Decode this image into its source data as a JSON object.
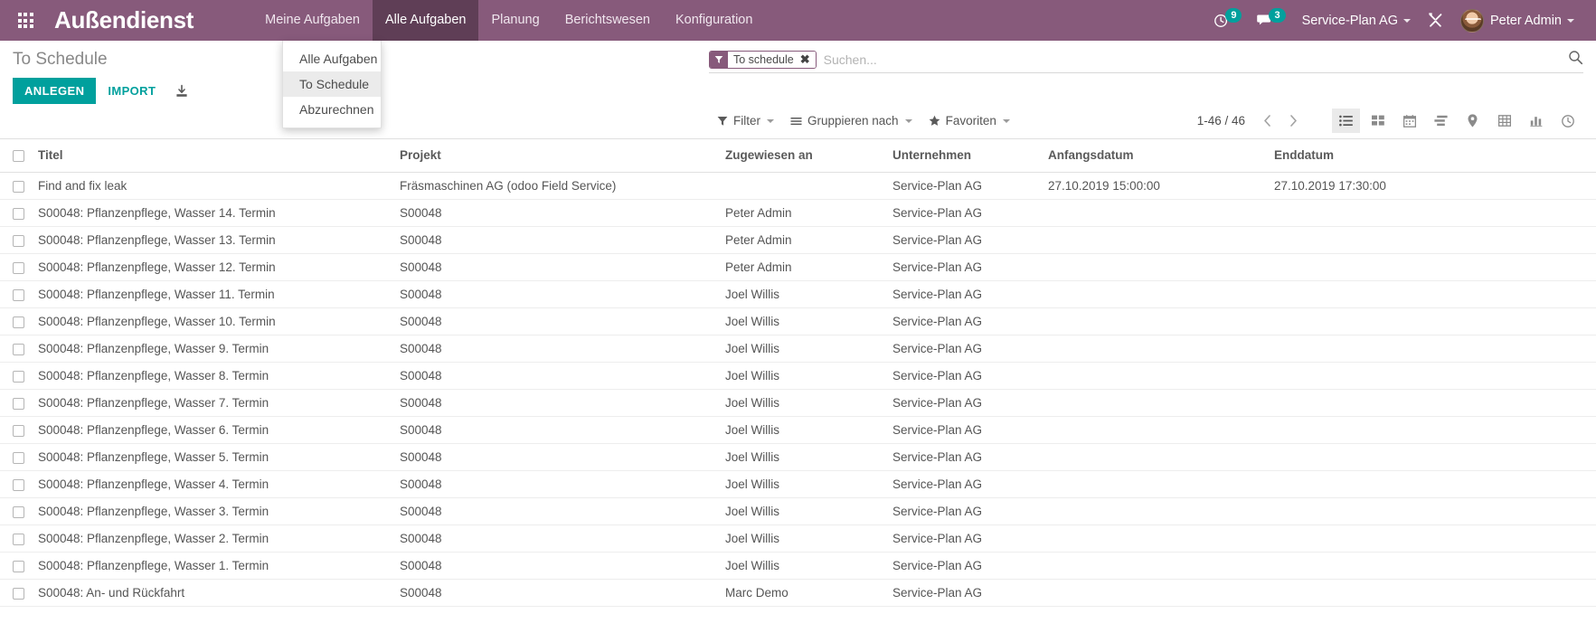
{
  "navbar": {
    "apps_icon": "apps-grid-icon",
    "brand": "Außendienst",
    "menu": [
      {
        "label": "Meine Aufgaben",
        "active": false
      },
      {
        "label": "Alle Aufgaben",
        "active": true
      },
      {
        "label": "Planung",
        "active": false
      },
      {
        "label": "Berichtswesen",
        "active": false
      },
      {
        "label": "Konfiguration",
        "active": false
      }
    ],
    "activity_count": "9",
    "messages_count": "3",
    "company": "Service-Plan AG",
    "debug_icon": "wrench-screwdriver-icon",
    "user": "Peter Admin"
  },
  "dropdown": {
    "items": [
      {
        "label": "Alle Aufgaben",
        "selected": false
      },
      {
        "label": "To Schedule",
        "selected": true
      },
      {
        "label": "Abzurechnen",
        "selected": false
      }
    ]
  },
  "control": {
    "title": "To Schedule",
    "create_label": "ANLEGEN",
    "import_label": "IMPORT",
    "download_icon": "download-icon",
    "search": {
      "facet_label": "To schedule",
      "facet_icon": "filter-funnel-icon",
      "facet_remove_icon": "remove-facet-icon",
      "placeholder": "Suchen...",
      "search_icon": "search-icon"
    },
    "filters": [
      {
        "label": "Filter",
        "icon": "filter-funnel-icon"
      },
      {
        "label": "Gruppieren nach",
        "icon": "bars-icon"
      },
      {
        "label": "Favoriten",
        "icon": "star-icon"
      }
    ],
    "pager": {
      "count": "1-46 / 46",
      "prev_icon": "chevron-left-icon",
      "next_icon": "chevron-right-icon"
    },
    "views": [
      {
        "name": "list-view",
        "icon": "list-icon",
        "active": true
      },
      {
        "name": "kanban-view",
        "icon": "kanban-icon",
        "active": false
      },
      {
        "name": "calendar-view",
        "icon": "calendar-icon",
        "active": false
      },
      {
        "name": "gantt-view",
        "icon": "gantt-icon",
        "active": false
      },
      {
        "name": "map-view",
        "icon": "map-pin-icon",
        "active": false
      },
      {
        "name": "pivot-view",
        "icon": "pivot-grid-icon",
        "active": false
      },
      {
        "name": "graph-view",
        "icon": "bar-chart-icon",
        "active": false
      },
      {
        "name": "activity-view",
        "icon": "clock-icon",
        "active": false
      }
    ]
  },
  "table": {
    "columns": [
      "Titel",
      "Projekt",
      "Zugewiesen an",
      "Unternehmen",
      "Anfangsdatum",
      "Enddatum"
    ],
    "rows": [
      {
        "title": "Find and fix leak",
        "project": "Fräsmaschinen AG (odoo Field Service)",
        "assigned": "",
        "company": "Service-Plan AG",
        "start": "27.10.2019 15:00:00",
        "end": "27.10.2019 17:30:00"
      },
      {
        "title": "S00048: Pflanzenpflege, Wasser 14. Termin",
        "project": "S00048",
        "assigned": "Peter Admin",
        "company": "Service-Plan AG",
        "start": "",
        "end": ""
      },
      {
        "title": "S00048: Pflanzenpflege, Wasser 13. Termin",
        "project": "S00048",
        "assigned": "Peter Admin",
        "company": "Service-Plan AG",
        "start": "",
        "end": ""
      },
      {
        "title": "S00048: Pflanzenpflege, Wasser 12. Termin",
        "project": "S00048",
        "assigned": "Peter Admin",
        "company": "Service-Plan AG",
        "start": "",
        "end": ""
      },
      {
        "title": "S00048: Pflanzenpflege, Wasser 11. Termin",
        "project": "S00048",
        "assigned": "Joel Willis",
        "company": "Service-Plan AG",
        "start": "",
        "end": ""
      },
      {
        "title": "S00048: Pflanzenpflege, Wasser 10. Termin",
        "project": "S00048",
        "assigned": "Joel Willis",
        "company": "Service-Plan AG",
        "start": "",
        "end": ""
      },
      {
        "title": "S00048: Pflanzenpflege, Wasser 9. Termin",
        "project": "S00048",
        "assigned": "Joel Willis",
        "company": "Service-Plan AG",
        "start": "",
        "end": ""
      },
      {
        "title": "S00048: Pflanzenpflege, Wasser 8. Termin",
        "project": "S00048",
        "assigned": "Joel Willis",
        "company": "Service-Plan AG",
        "start": "",
        "end": ""
      },
      {
        "title": "S00048: Pflanzenpflege, Wasser 7. Termin",
        "project": "S00048",
        "assigned": "Joel Willis",
        "company": "Service-Plan AG",
        "start": "",
        "end": ""
      },
      {
        "title": "S00048: Pflanzenpflege, Wasser 6. Termin",
        "project": "S00048",
        "assigned": "Joel Willis",
        "company": "Service-Plan AG",
        "start": "",
        "end": ""
      },
      {
        "title": "S00048: Pflanzenpflege, Wasser 5. Termin",
        "project": "S00048",
        "assigned": "Joel Willis",
        "company": "Service-Plan AG",
        "start": "",
        "end": ""
      },
      {
        "title": "S00048: Pflanzenpflege, Wasser 4. Termin",
        "project": "S00048",
        "assigned": "Joel Willis",
        "company": "Service-Plan AG",
        "start": "",
        "end": ""
      },
      {
        "title": "S00048: Pflanzenpflege, Wasser 3. Termin",
        "project": "S00048",
        "assigned": "Joel Willis",
        "company": "Service-Plan AG",
        "start": "",
        "end": ""
      },
      {
        "title": "S00048: Pflanzenpflege, Wasser 2. Termin",
        "project": "S00048",
        "assigned": "Joel Willis",
        "company": "Service-Plan AG",
        "start": "",
        "end": ""
      },
      {
        "title": "S00048: Pflanzenpflege, Wasser 1. Termin",
        "project": "S00048",
        "assigned": "Joel Willis",
        "company": "Service-Plan AG",
        "start": "",
        "end": ""
      },
      {
        "title": "S00048: An- und Rückfahrt",
        "project": "S00048",
        "assigned": "Marc Demo",
        "company": "Service-Plan AG",
        "start": "",
        "end": ""
      }
    ]
  },
  "colors": {
    "brand_purple": "#875A7B",
    "brand_purple_dark": "#5f3e56",
    "accent_teal": "#00A09D"
  }
}
